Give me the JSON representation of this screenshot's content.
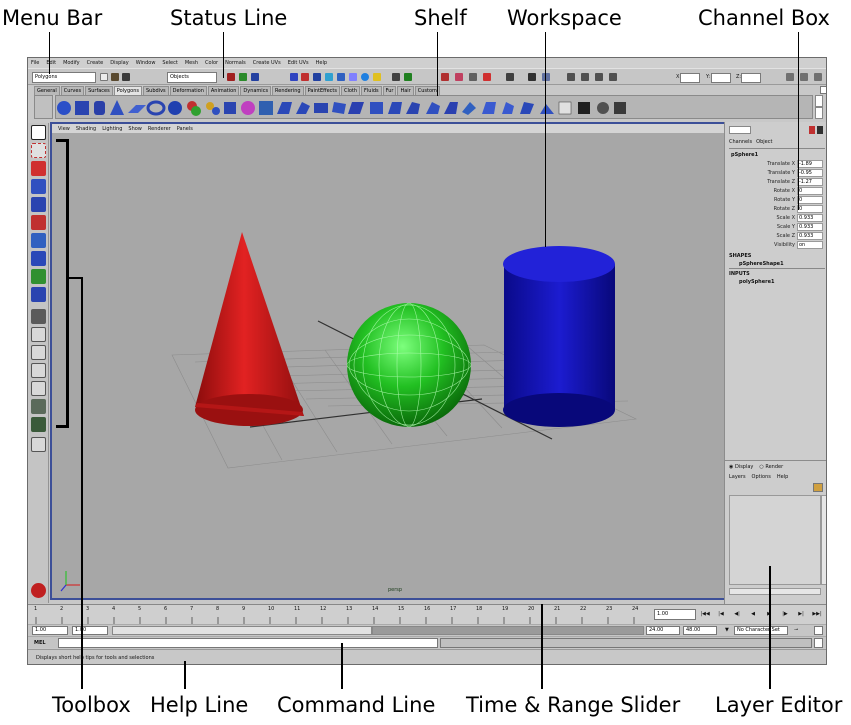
{
  "callouts": {
    "menu_bar": "Menu Bar",
    "status_line": "Status Line",
    "shelf": "Shelf",
    "workspace": "Workspace",
    "channel_box": "Channel Box",
    "toolbox": "Toolbox",
    "help_line": "Help Line",
    "command_line": "Command Line",
    "time_range_slider": "Time & Range Slider",
    "layer_editor": "Layer Editor"
  },
  "menu": [
    "File",
    "Edit",
    "Modify",
    "Create",
    "Display",
    "Window",
    "Select",
    "Mesh",
    "Color",
    "Normals",
    "Create UVs",
    "Edit UVs",
    "Help"
  ],
  "status_line": {
    "menu_set": "Polygons",
    "selection_mode": "Objects",
    "x_label": "X:",
    "y_label": "Y:",
    "z_label": "Z:"
  },
  "shelf_tabs": [
    "General",
    "Curves",
    "Surfaces",
    "Polygons",
    "Subdivs",
    "Deformation",
    "Animation",
    "Dynamics",
    "Rendering",
    "PaintEffects",
    "Cloth",
    "Fluids",
    "Fur",
    "Hair",
    "Custom"
  ],
  "shelf_active_tab": "Polygons",
  "panel_menu": [
    "View",
    "Shading",
    "Lighting",
    "Show",
    "Renderer",
    "Panels"
  ],
  "viewport": {
    "camera_label": "persp",
    "objects": [
      {
        "name": "cone",
        "color": "#c81818"
      },
      {
        "name": "sphere",
        "color": "#1fbf1f"
      },
      {
        "name": "cylinder",
        "color": "#1414c0"
      }
    ]
  },
  "channel_box": {
    "tabs": [
      "Channels",
      "Object"
    ],
    "object_name": "pSphere1",
    "channels": [
      {
        "label": "Translate X",
        "value": "-1.89"
      },
      {
        "label": "Translate Y",
        "value": "-0.95"
      },
      {
        "label": "Translate Z",
        "value": "-1.27"
      },
      {
        "label": "Rotate X",
        "value": "0"
      },
      {
        "label": "Rotate Y",
        "value": "0"
      },
      {
        "label": "Rotate Z",
        "value": "0"
      },
      {
        "label": "Scale X",
        "value": "0.933"
      },
      {
        "label": "Scale Y",
        "value": "0.933"
      },
      {
        "label": "Scale Z",
        "value": "0.933"
      },
      {
        "label": "Visibility",
        "value": "on"
      }
    ],
    "shapes_header": "SHAPES",
    "shape_name": "pSphereShape1",
    "inputs_header": "INPUTS",
    "input_name": "polySphere1"
  },
  "layer_editor": {
    "radio_display": "Display",
    "radio_render": "Render",
    "menu": [
      "Layers",
      "Options",
      "Help"
    ]
  },
  "time_slider": {
    "ticks": [
      "1",
      "2",
      "3",
      "4",
      "5",
      "6",
      "7",
      "8",
      "9",
      "10",
      "11",
      "12",
      "13",
      "14",
      "15",
      "16",
      "17",
      "18",
      "19",
      "20",
      "21",
      "22",
      "23",
      "24"
    ],
    "current_frame": "1.00"
  },
  "range_slider": {
    "start": "1.00",
    "start_inner": "1.00",
    "end_inner": "24.00",
    "end": "48.00",
    "character_set": "No Character Set"
  },
  "command_line": {
    "label": "MEL"
  },
  "help_line": {
    "text": "Displays short help tips for tools and selections"
  },
  "colors": {
    "viewport_border": "#3c4f98",
    "viewport_bg": "#a7a7a7",
    "cone": "#c81818",
    "sphere": "#1fbf1f",
    "cylinder": "#1414c0"
  }
}
